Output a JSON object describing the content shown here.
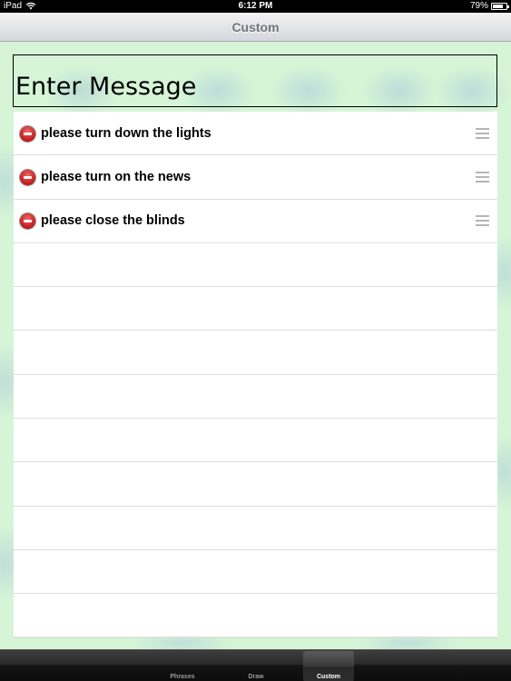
{
  "status_bar": {
    "device": "iPad",
    "time": "6:12 PM",
    "battery": "79%",
    "battery_level": 0.79
  },
  "nav": {
    "title": "Custom"
  },
  "message": {
    "placeholder": "Enter Message"
  },
  "phrases": [
    {
      "label": "please turn down the lights"
    },
    {
      "label": "please turn on the news"
    },
    {
      "label": "please close the blinds"
    }
  ],
  "empty_row_count": 9,
  "tabs": [
    {
      "label": "Phrases",
      "selected": false
    },
    {
      "label": "Draw",
      "selected": false
    },
    {
      "label": "Custom",
      "selected": true
    }
  ],
  "colors": {
    "background": "#d6f5d6",
    "delete": "#c51d1d",
    "nav_title": "#70757d"
  }
}
